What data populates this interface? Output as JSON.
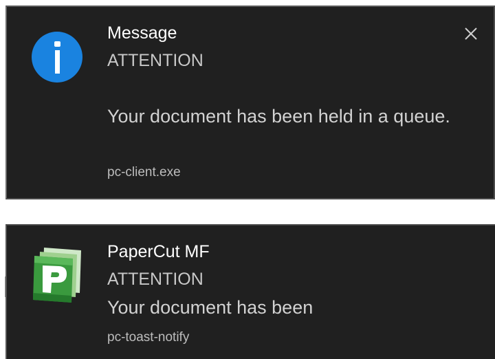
{
  "toasts": [
    {
      "icon": "info-icon",
      "title": "Message",
      "subtitle": "ATTENTION",
      "body": "Your document has been held in a queue.",
      "app": "pc-client.exe",
      "close_icon": "close-icon"
    },
    {
      "icon": "papercut-logo-icon",
      "title": "PaperCut MF",
      "subtitle": "ATTENTION",
      "body": "Your document has been",
      "app": "pc-toast-notify"
    }
  ],
  "colors": {
    "toast_background": "#202020",
    "info_blue": "#1a83e0",
    "papercut_green": "#3a9a3e"
  }
}
